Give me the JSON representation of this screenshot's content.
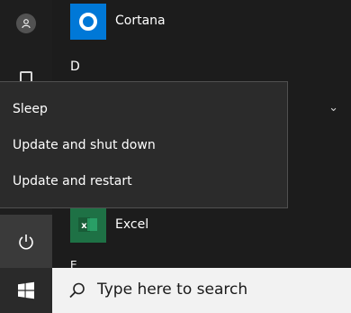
{
  "apps": {
    "cortana_label": "Cortana",
    "section_d": "D",
    "excel_label": "Excel",
    "excel_tile_letter": "x",
    "section_e": "E"
  },
  "power_menu": {
    "items": [
      "Sleep",
      "Update and shut down",
      "Update and restart"
    ]
  },
  "taskbar": {
    "search_placeholder": "Type here to search"
  },
  "icons": {
    "user": "user-icon",
    "documents": "document-icon",
    "power": "power-icon",
    "start": "windows-logo-icon",
    "search": "search-icon",
    "expand": "chevron-down-icon"
  },
  "colors": {
    "cortana_tile": "#0078d7",
    "excel_tile": "#1e7145"
  }
}
